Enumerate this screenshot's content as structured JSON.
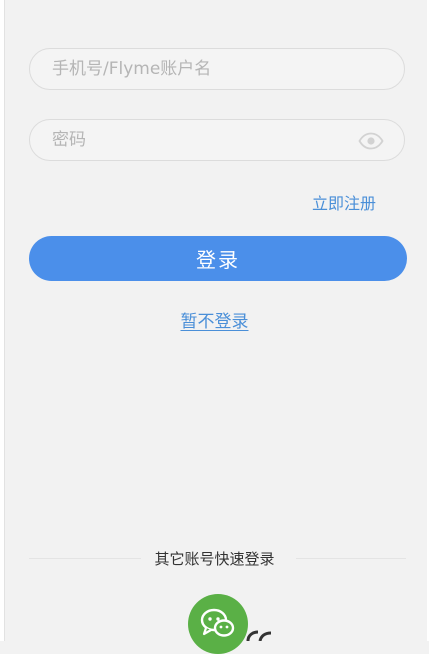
{
  "login_form": {
    "username_placeholder": "手机号/Flyme账户名",
    "password_placeholder": "密码",
    "password_visibility_icon": "eye-icon",
    "register_label": "立即注册",
    "login_label": "登录",
    "skip_label": "暂不登录"
  },
  "other_login": {
    "label": "其它账号快速登录",
    "providers": [
      {
        "icon": "wechat-icon",
        "color": "#5ab046"
      }
    ]
  },
  "colors": {
    "background": "#f2f2f2",
    "primary_button": "#4b8fea",
    "link": "#4a8fd8",
    "wechat": "#5ab046"
  }
}
